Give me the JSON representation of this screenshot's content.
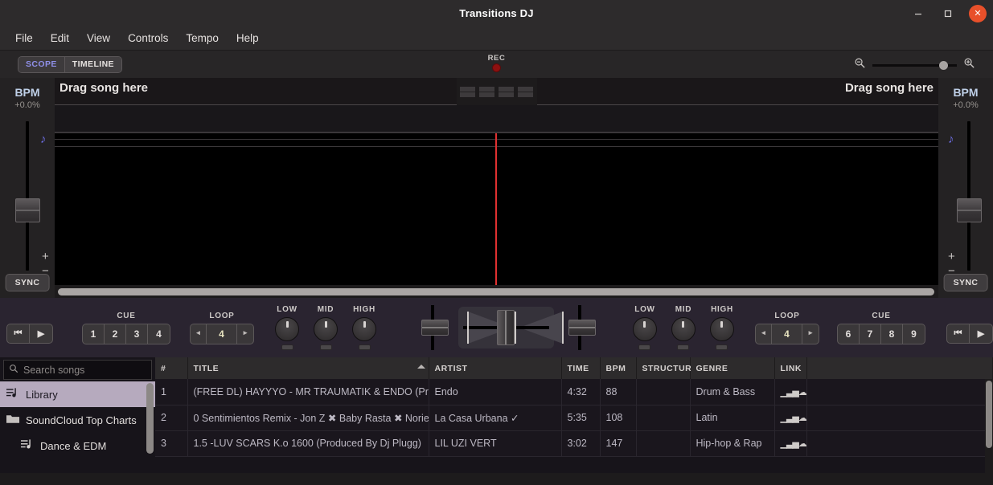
{
  "window": {
    "title": "Transitions DJ",
    "minimize_icon": "minimize-icon",
    "maximize_icon": "maximize-icon",
    "close_icon": "close-icon",
    "close_glyph": "✕"
  },
  "menubar": {
    "items": [
      "File",
      "Edit",
      "View",
      "Controls",
      "Tempo",
      "Help"
    ]
  },
  "toolbar": {
    "view_tabs": [
      {
        "label": "SCOPE",
        "selected": true
      },
      {
        "label": "TIMELINE",
        "selected": false
      }
    ],
    "rec_label": "REC",
    "rec_indicator": "record-dot",
    "zoom_out_icon": "zoom-out-icon",
    "zoom_in_icon": "zoom-in-icon",
    "zoom_value": 79
  },
  "deck_left": {
    "bpm_label": "BPM",
    "bpm_percent": "+0.0%",
    "note_icon": "music-note-icon",
    "plus_label": "+",
    "minus_label": "−",
    "sync_label": "SYNC",
    "drag_text": "Drag song here"
  },
  "deck_right": {
    "bpm_label": "BPM",
    "bpm_percent": "+0.0%",
    "note_icon": "music-note-icon",
    "plus_label": "+",
    "minus_label": "−",
    "sync_label": "SYNC",
    "drag_text": "Drag song here"
  },
  "beat_segments": 4,
  "mixer": {
    "left": {
      "transport": [
        {
          "icon": "skip-to-start-icon",
          "glyph": "⏮"
        },
        {
          "icon": "play-icon",
          "glyph": "▶"
        }
      ],
      "cue_label": "CUE",
      "cue_buttons": [
        "1",
        "2",
        "3",
        "4"
      ],
      "loop_label": "LOOP",
      "loop_prev_glyph": "◂",
      "loop_value": "4",
      "loop_next_glyph": "▸",
      "eq": [
        {
          "label": "LOW"
        },
        {
          "label": "MID"
        },
        {
          "label": "HIGH"
        }
      ]
    },
    "right": {
      "transport": [
        {
          "icon": "skip-to-start-icon",
          "glyph": "⏮"
        },
        {
          "icon": "play-icon",
          "glyph": "▶"
        }
      ],
      "cue_label": "CUE",
      "cue_buttons": [
        "6",
        "7",
        "8",
        "9"
      ],
      "loop_label": "LOOP",
      "loop_prev_glyph": "◂",
      "loop_value": "4",
      "loop_next_glyph": "▸",
      "eq": [
        {
          "label": "LOW"
        },
        {
          "label": "MID"
        },
        {
          "label": "HIGH"
        }
      ]
    }
  },
  "sidebar": {
    "search_placeholder": "Search songs",
    "search_value": "",
    "search_icon": "search-icon",
    "items": [
      {
        "label": "Library",
        "icon": "playlist-icon",
        "selected": true,
        "indent": false
      },
      {
        "label": "SoundCloud Top Charts",
        "icon": "folder-icon",
        "selected": false,
        "indent": false
      },
      {
        "label": "Dance & EDM",
        "icon": "playlist-icon",
        "selected": false,
        "indent": true
      }
    ]
  },
  "table": {
    "columns": [
      "#",
      "TITLE",
      "ARTIST",
      "TIME",
      "BPM",
      "STRUCTURE",
      "GENRE",
      "LINK"
    ],
    "sorted_column": "TITLE",
    "sort_direction": "asc",
    "rows": [
      {
        "num": "1",
        "title": "(FREE DL) HAYYYO - MR TRAUMATIK & ENDO (Prod",
        "artist": "Endo",
        "time": "4:32",
        "bpm": "88",
        "structure": "",
        "genre": "Drum & Bass",
        "link": "soundcloud-icon"
      },
      {
        "num": "2",
        "title": "0 Sentimientos Remix - Jon Z ✖ Baby Rasta ✖ Norie",
        "artist": "La Casa Urbana ✓",
        "time": "5:35",
        "bpm": "108",
        "structure": "",
        "genre": "Latin",
        "link": "soundcloud-icon"
      },
      {
        "num": "3",
        "title": "1.5 -LUV SCARS K.o 1600 (Produced By Dj Plugg)",
        "artist": "LIL UZI VERT",
        "time": "3:02",
        "bpm": "147",
        "structure": "",
        "genre": "Hip-hop & Rap",
        "link": "soundcloud-icon"
      }
    ]
  }
}
